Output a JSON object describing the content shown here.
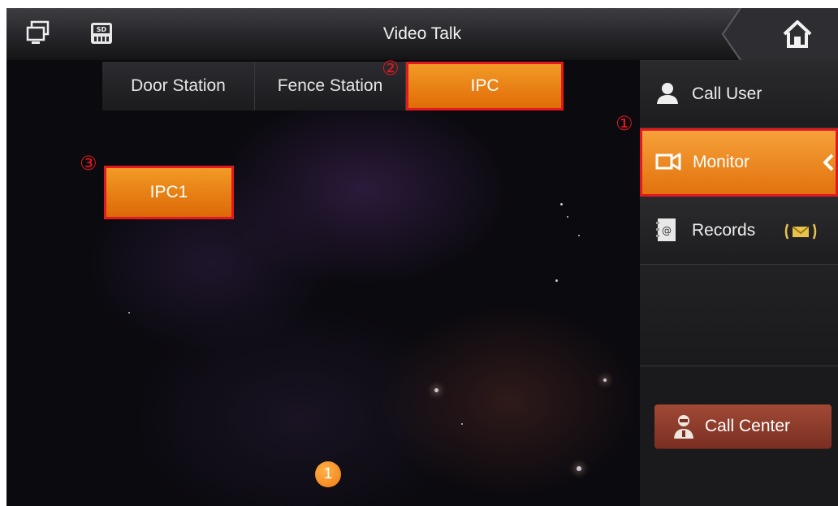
{
  "titlebar": {
    "title": "Video Talk",
    "left_icons": [
      "monitor-network-icon",
      "sd-card-icon"
    ],
    "right_icon": "home-icon"
  },
  "tabs": [
    {
      "label": "Door Station",
      "active": false
    },
    {
      "label": "Fence Station",
      "active": false
    },
    {
      "label": "IPC",
      "active": true
    }
  ],
  "devices": [
    {
      "label": "IPC1"
    }
  ],
  "markers": {
    "one": "①",
    "two": "②",
    "three": "③"
  },
  "page_indicator": "1",
  "sidebar": {
    "items": [
      {
        "label": "Call User",
        "icon": "user-icon",
        "active": false
      },
      {
        "label": "Monitor",
        "icon": "camera-icon",
        "active": true
      },
      {
        "label": "Records",
        "icon": "records-icon",
        "active": false,
        "badge_icon": "envelope-icon"
      }
    ],
    "call_center": {
      "label": "Call Center",
      "icon": "call-center-icon"
    }
  },
  "colors": {
    "accent": "#ee8a1a",
    "highlight_border": "#e3191f",
    "call_center": "#8c3a2a"
  }
}
